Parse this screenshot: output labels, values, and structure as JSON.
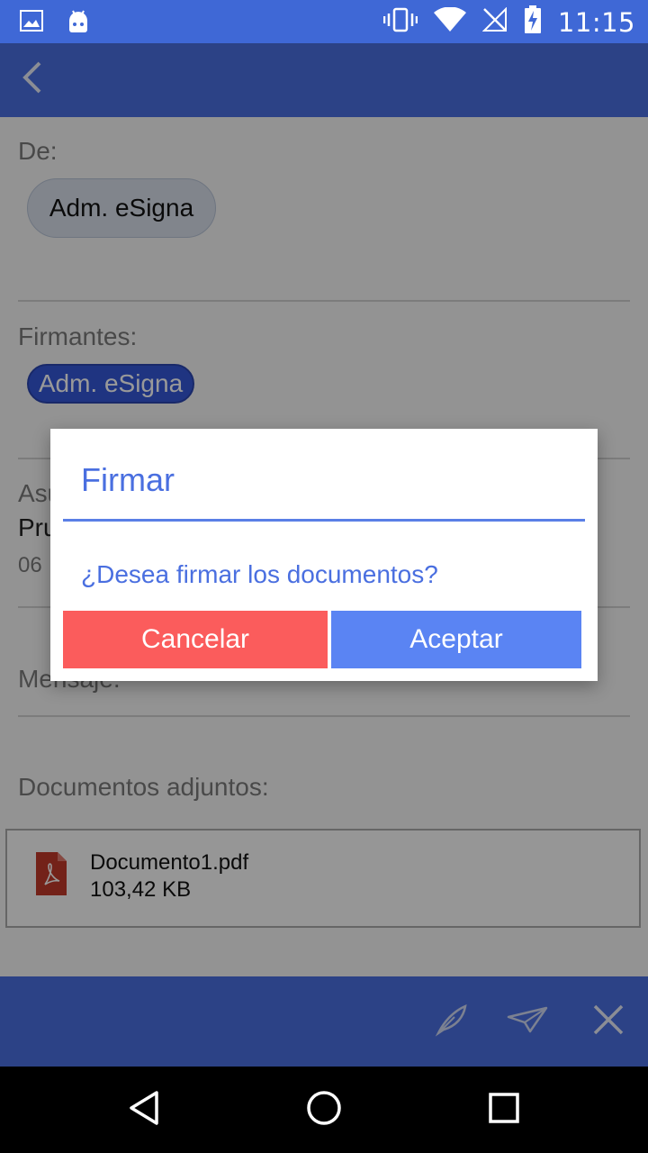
{
  "status_bar": {
    "time": "11:15"
  },
  "form": {
    "from_label": "De:",
    "sender_chip": "Adm. eSigna",
    "signers_label": "Firmantes:",
    "signer_chip": "Adm. eSigna",
    "subject_label": "Asunto:",
    "subject_value": "Prueba",
    "subject_date": "06",
    "message_label": "Mensaje:",
    "attachments_label": "Documentos adjuntos:",
    "attachments": [
      {
        "name": "Documento1.pdf",
        "size": "103,42 KB"
      }
    ]
  },
  "dialog": {
    "title": "Firmar",
    "message": "¿Desea firmar los documentos?",
    "cancel_label": "Cancelar",
    "accept_label": "Aceptar"
  },
  "colors": {
    "primary": "#4a6fe0",
    "cancel": "#fb5c5c",
    "accept": "#5a84f3"
  },
  "icons": {
    "back": "chevron-left-icon",
    "sign": "feather-icon",
    "send": "paper-plane-icon",
    "close": "close-icon",
    "pdf": "pdf-file-icon"
  }
}
